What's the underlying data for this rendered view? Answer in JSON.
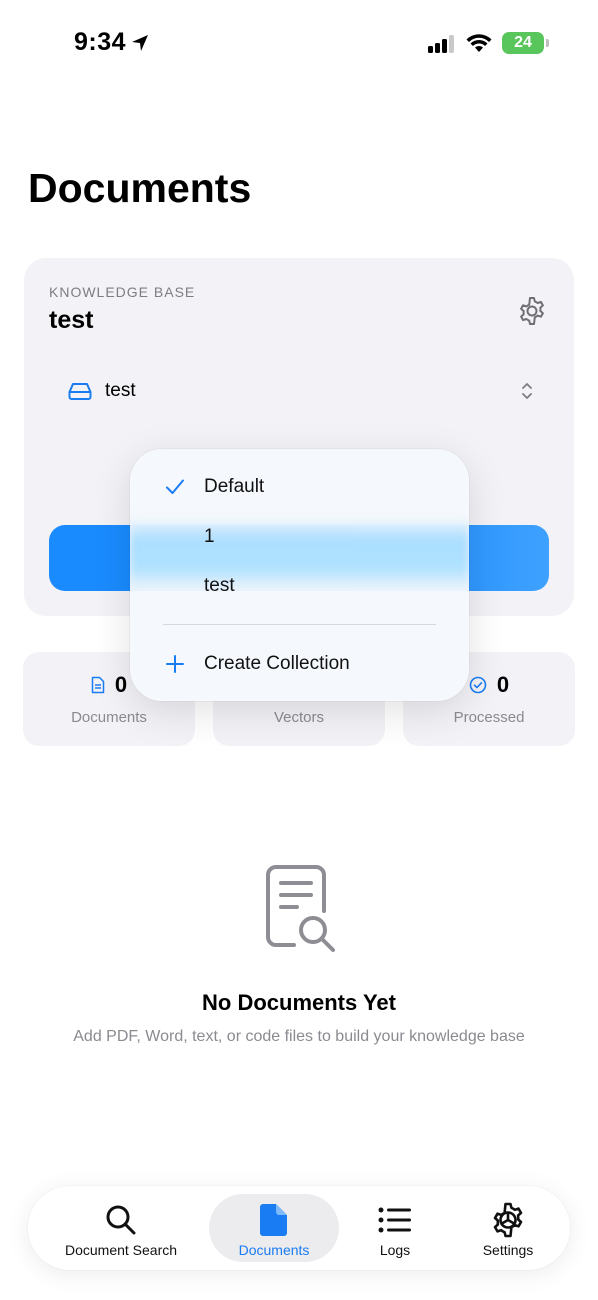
{
  "status_bar": {
    "time": "9:34",
    "battery": "24"
  },
  "page": {
    "title": "Documents"
  },
  "knowledge_base": {
    "eyebrow": "KNOWLEDGE BASE",
    "name": "test",
    "collection_selected": "test"
  },
  "stats": [
    {
      "value": "0",
      "label": "Documents"
    },
    {
      "value": "",
      "label": "Vectors"
    },
    {
      "value": "0",
      "label": "Processed"
    }
  ],
  "menu": {
    "items": [
      {
        "label": "Default",
        "checked": true
      },
      {
        "label": "1"
      },
      {
        "label": "test"
      }
    ],
    "create_label": "Create Collection"
  },
  "empty_state": {
    "title": "No Documents Yet",
    "subtitle": "Add PDF, Word, text, or code files to build your knowledge base"
  },
  "tabs": [
    {
      "label": "Document Search",
      "icon": "search-icon"
    },
    {
      "label": "Documents",
      "icon": "document-icon",
      "active": true
    },
    {
      "label": "Logs",
      "icon": "list-icon"
    },
    {
      "label": "Settings",
      "icon": "settings-icon"
    }
  ],
  "colors": {
    "accent": "#1a8bff",
    "card_bg": "#f3f3f7",
    "battery": "#58c65b"
  }
}
